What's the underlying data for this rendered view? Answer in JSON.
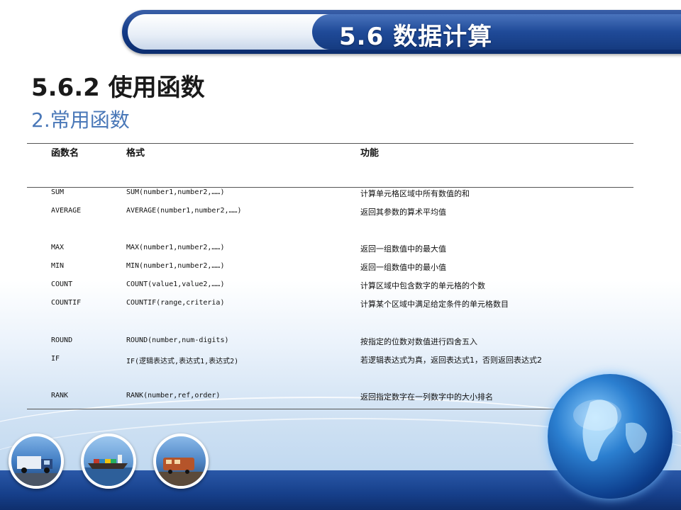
{
  "header": {
    "title": "5.6  数据计算"
  },
  "heading": "5.6.2  使用函数",
  "subheading": "2.常用函数",
  "table": {
    "columns": [
      "函数名",
      "格式",
      "功能"
    ],
    "rows": [
      {
        "name": "SUM",
        "format": "SUM(number1,number2,……)",
        "function": "计算单元格区域中所有数值的和"
      },
      {
        "name": "AVERAGE",
        "format": "AVERAGE(number1,number2,……)",
        "function": "返回其参数的算术平均值"
      },
      {
        "name": "MAX",
        "format": "MAX(number1,number2,……)",
        "function": "返回一组数值中的最大值"
      },
      {
        "name": "MIN",
        "format": "MIN(number1,number2,……)",
        "function": "返回一组数值中的最小值"
      },
      {
        "name": "COUNT",
        "format": "COUNT(value1,value2,……)",
        "function": "计算区域中包含数字的单元格的个数"
      },
      {
        "name": "COUNTIF",
        "format": "COUNTIF(range,criteria)",
        "function": "计算某个区域中满足给定条件的单元格数目"
      },
      {
        "name": "ROUND",
        "format": "ROUND(number,num-digits)",
        "function": "按指定的位数对数值进行四舍五入"
      },
      {
        "name": "IF",
        "format": "IF(逻辑表达式,表达式1,表达式2)",
        "function": "若逻辑表达式为真，返回表达式1，否则返回表达式2"
      },
      {
        "name": "RANK",
        "format": "RANK(number,ref,order)",
        "function": "返回指定数字在一列数字中的大小排名"
      }
    ]
  },
  "decor": {
    "photos": [
      "truck-icon",
      "cargo-ship-icon",
      "train-icon"
    ],
    "globe": "globe-icon",
    "accent": "#163f8a"
  }
}
